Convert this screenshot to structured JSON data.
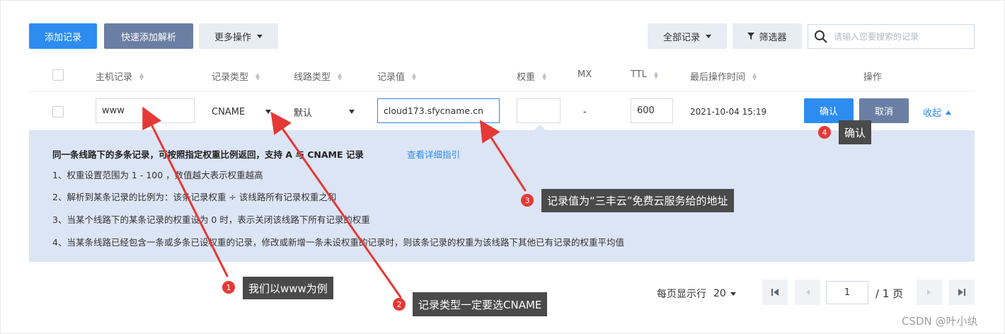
{
  "toolbar": {
    "add_record": "添加记录",
    "quick_add": "快速添加解析",
    "more_actions": "更多操作",
    "all_records": "全部记录",
    "filter": "筛选器",
    "search_placeholder": "请输入您要搜索的记录"
  },
  "table": {
    "headers": {
      "host": "主机记录",
      "type": "记录类型",
      "line": "线路类型",
      "value": "记录值",
      "weight": "权重",
      "mx": "MX",
      "ttl": "TTL",
      "last_op": "最后操作时间",
      "actions": "操作"
    },
    "edit_row": {
      "host": "www",
      "type": "CNAME",
      "line": "默认",
      "value": "cloud173.sfycname.cn",
      "weight": "",
      "mx": "-",
      "ttl": "600",
      "last_op": "2021-10-04 15:19",
      "confirm": "确认",
      "cancel": "取消",
      "collapse": "收起"
    }
  },
  "info_panel": {
    "title": "同一条线路下的多条记录，可按照指定权重比例返回，支持 A 与 CNAME 记录",
    "link": "查看详细指引",
    "lines": [
      "1、权重设置范围为 1 - 100 ，数值越大表示权重越高",
      "2、解析到某条记录的比例为：该条记录权重 ÷ 该线路所有记录权重之和",
      "3、当某个线路下的某条记录的权重设为 0 时，表示关闭该线路下所有记录的权重",
      "4、当某条线路已经包含一条或多条已设权重的记录，修改或新增一条未设权重的记录时，则该条记录的权重为该线路下其他已有记录的权重平均值"
    ]
  },
  "pagination": {
    "per_page_label": "每页显示行",
    "per_page": "20",
    "current_page": "1",
    "total_pages": "/ 1 页"
  },
  "annotations": [
    {
      "num": "1",
      "text": "我们以www为例"
    },
    {
      "num": "2",
      "text": "记录类型一定要选CNAME"
    },
    {
      "num": "3",
      "text": "记录值为“三丰云”免费云服务给的地址"
    },
    {
      "num": "4",
      "text": "确认"
    }
  ],
  "watermark": "CSDN @叶小纨",
  "colors": {
    "primary": "#2d8cf0",
    "slate": "#6a7fa3",
    "panel_bg": "#dce5f5",
    "annotation_red": "#e53935",
    "annotation_bg": "#4a4a4a"
  }
}
